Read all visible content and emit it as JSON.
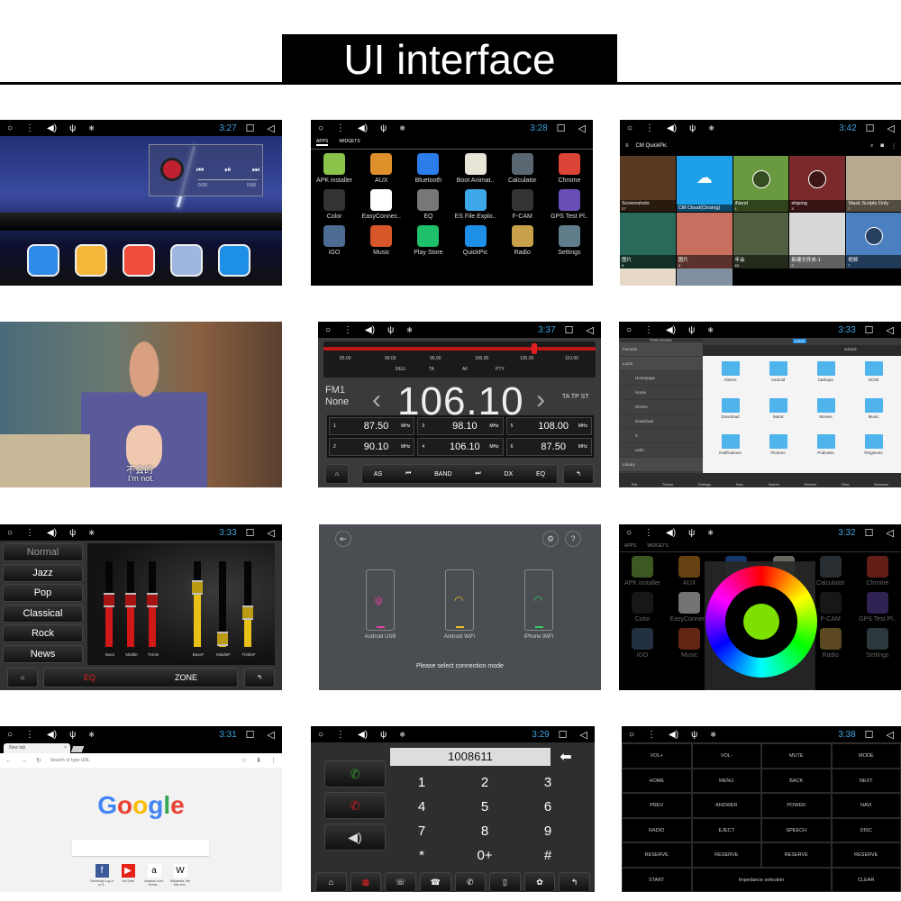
{
  "header": {
    "title": "UI interface"
  },
  "home": {
    "time": "3:27",
    "player": {
      "elapsed": "0:00",
      "total": "0:00"
    },
    "dock": [
      {
        "icon": "navigation-icon",
        "color": "#2f8ae8"
      },
      {
        "icon": "chrome-icon",
        "color": "#f4b73a"
      },
      {
        "icon": "apps-grid-icon",
        "color": "#f04b3c"
      },
      {
        "icon": "bluetooth-icon",
        "color": "#9fb6e0"
      },
      {
        "icon": "video-icon",
        "color": "#1e8fe6"
      }
    ]
  },
  "apps": {
    "time": "3:28",
    "tabs": [
      "APPS",
      "WIDGETS"
    ],
    "items": [
      {
        "label": "APK installer",
        "color": "#8bc34a"
      },
      {
        "label": "AUX",
        "color": "#e0902a"
      },
      {
        "label": "Bluetooth",
        "color": "#2b7de9"
      },
      {
        "label": "Boot Animat..",
        "color": "#e9e4d8"
      },
      {
        "label": "Calculator",
        "color": "#5b6770"
      },
      {
        "label": "Chrome",
        "color": "#db4437"
      },
      {
        "label": "Color",
        "color": "#333"
      },
      {
        "label": "EasyConnec..",
        "color": "#fff"
      },
      {
        "label": "EQ",
        "color": "#777"
      },
      {
        "label": "ES File Explo..",
        "color": "#3da8e8"
      },
      {
        "label": "F-CAM",
        "color": "#333"
      },
      {
        "label": "GPS Test Pl..",
        "color": "#6b4fb8"
      },
      {
        "label": "iGO",
        "color": "#4d6b93"
      },
      {
        "label": "Music",
        "color": "#d8572a"
      },
      {
        "label": "Play Store",
        "color": "#1ec06a"
      },
      {
        "label": "QuickPic",
        "color": "#1e8fe6"
      },
      {
        "label": "Radio",
        "color": "#c9a04a"
      },
      {
        "label": "Settings",
        "color": "#607d8b"
      }
    ]
  },
  "quickpic": {
    "time": "3:42",
    "title": "CM QuickPic",
    "albums": [
      {
        "name": "Screenshots",
        "count": "27",
        "color": "#5a3a20"
      },
      {
        "name": "CM Cloud(Closing)",
        "count": "",
        "color": "#1ea0e8"
      },
      {
        "name": "iNand",
        "count": "1",
        "color": "#6a9a40"
      },
      {
        "name": "shiping",
        "count": "3",
        "color": "#7a2a2a"
      },
      {
        "name": "Stack Scripts Only",
        "count": "7",
        "color": "#b8a890"
      },
      {
        "name": "图片",
        "count": "9",
        "color": "#2a6a5a"
      },
      {
        "name": "图片",
        "count": "3",
        "color": "#c87060"
      },
      {
        "name": "年会",
        "count": "63",
        "color": "#506040"
      },
      {
        "name": "新建文件夹-1",
        "count": "2",
        "color": "#d8d8d8"
      },
      {
        "name": "视频",
        "count": "7",
        "color": "#4a80c0"
      }
    ]
  },
  "video": {
    "subtitle_cn": "不会的",
    "subtitle_en": "I'm not."
  },
  "radio": {
    "time": "3:37",
    "scale": [
      "85.00",
      "90.00",
      "95.00",
      "100.00",
      "105.00",
      "110.00"
    ],
    "flags": [
      "REG",
      "TA",
      "AF",
      "PTY"
    ],
    "band": "FM1",
    "pty": "None",
    "frequency": "106.10",
    "indicators": "TA TP ST",
    "unit": "MHz",
    "presets": [
      {
        "n": "1",
        "f": "87.50"
      },
      {
        "n": "3",
        "f": "98.10"
      },
      {
        "n": "5",
        "f": "108.00"
      },
      {
        "n": "2",
        "f": "90.10"
      },
      {
        "n": "4",
        "f": "106.10"
      },
      {
        "n": "6",
        "f": "87.50"
      }
    ],
    "controls": [
      "AS",
      "⏮",
      "BAND",
      "⏭",
      "DX",
      "EQ"
    ],
    "tuned_mhz": 106.1
  },
  "files": {
    "time": "3:33",
    "quick_access": "Fast Access",
    "tab": "Local",
    "path": "sdcard",
    "sidebar": [
      "Favorite",
      "Local",
      "Homepage",
      "Home",
      "Device",
      "Download",
      "0",
      "usb2",
      "Library"
    ],
    "folders": [
      "Alarms",
      "Android",
      "backups",
      "DCIM",
      "Download",
      "iNand",
      "Movies",
      "Music",
      "Notifications",
      "Pictures",
      "Podcasts",
      "Ringtones"
    ],
    "toolbar": [
      "Exit",
      "Theme",
      "Settings",
      "New",
      "Search",
      "Refresh",
      "View",
      "Windows"
    ]
  },
  "eq": {
    "time": "3:33",
    "presets": [
      "Normal",
      "Jazz",
      "Pop",
      "Classical",
      "Rock",
      "News"
    ],
    "sliders": [
      {
        "label": "Bass",
        "level": 0.6,
        "color": "#d01818"
      },
      {
        "label": "Middle",
        "level": 0.6,
        "color": "#d01818"
      },
      {
        "label": "Treble",
        "level": 0.6,
        "color": "#d01818"
      },
      {
        "label": "BassF",
        "level": 0.75,
        "color": "#e8c018"
      },
      {
        "label": "MiddleF",
        "level": 0.15,
        "color": "#e8c018"
      },
      {
        "label": "TrebleF",
        "level": 0.45,
        "color": "#e8c018"
      }
    ],
    "tabs": [
      "EQ",
      "ZONE"
    ],
    "active_color": "#e02020"
  },
  "connect": {
    "options": [
      {
        "label": "Android USB",
        "color": "#e040a0",
        "icon": "usb-icon"
      },
      {
        "label": "Android WiFi",
        "color": "#f0c020",
        "icon": "wifi-icon"
      },
      {
        "label": "iPhone WiFi",
        "color": "#30d060",
        "icon": "wifi-icon"
      }
    ],
    "prompt": "Please select connection mode"
  },
  "colorwheel": {
    "time": "3:32",
    "center_color": "#7ee000"
  },
  "browser": {
    "time": "3:31",
    "tab": "New tab",
    "url_placeholder": "Search or type URL",
    "logo": "Google",
    "shortcuts": [
      {
        "label": "Facebook Log in or S..",
        "icon": "f",
        "color": "#3b5998"
      },
      {
        "label": "YouTube",
        "icon": "▶",
        "color": "#e62117"
      },
      {
        "label": "Amazon.com: Online ..",
        "icon": "a",
        "color": "#fff"
      },
      {
        "label": "Wikipedia, the free enc..",
        "icon": "W",
        "color": "#fff"
      }
    ]
  },
  "dialer": {
    "time": "3:29",
    "number": "1008611",
    "keys": [
      "1",
      "2",
      "3",
      "4",
      "5",
      "6",
      "7",
      "8",
      "9",
      "*",
      "0+",
      "#"
    ]
  },
  "keys": {
    "time": "3:38",
    "rows": [
      [
        "VOL+",
        "VOL-",
        "MUTE",
        "MODE"
      ],
      [
        "HOME",
        "MENU",
        "BACK",
        "NEXT"
      ],
      [
        "PREV",
        "ANSWER",
        "POWER",
        "NAVI"
      ],
      [
        "RADIO",
        "EJECT",
        "SPEECH",
        "DISC"
      ],
      [
        "RESERVE",
        "RESERVE",
        "RESERVE",
        "RESERVE"
      ]
    ],
    "last": [
      "START",
      "Impedance selection",
      "CLEAR"
    ]
  }
}
